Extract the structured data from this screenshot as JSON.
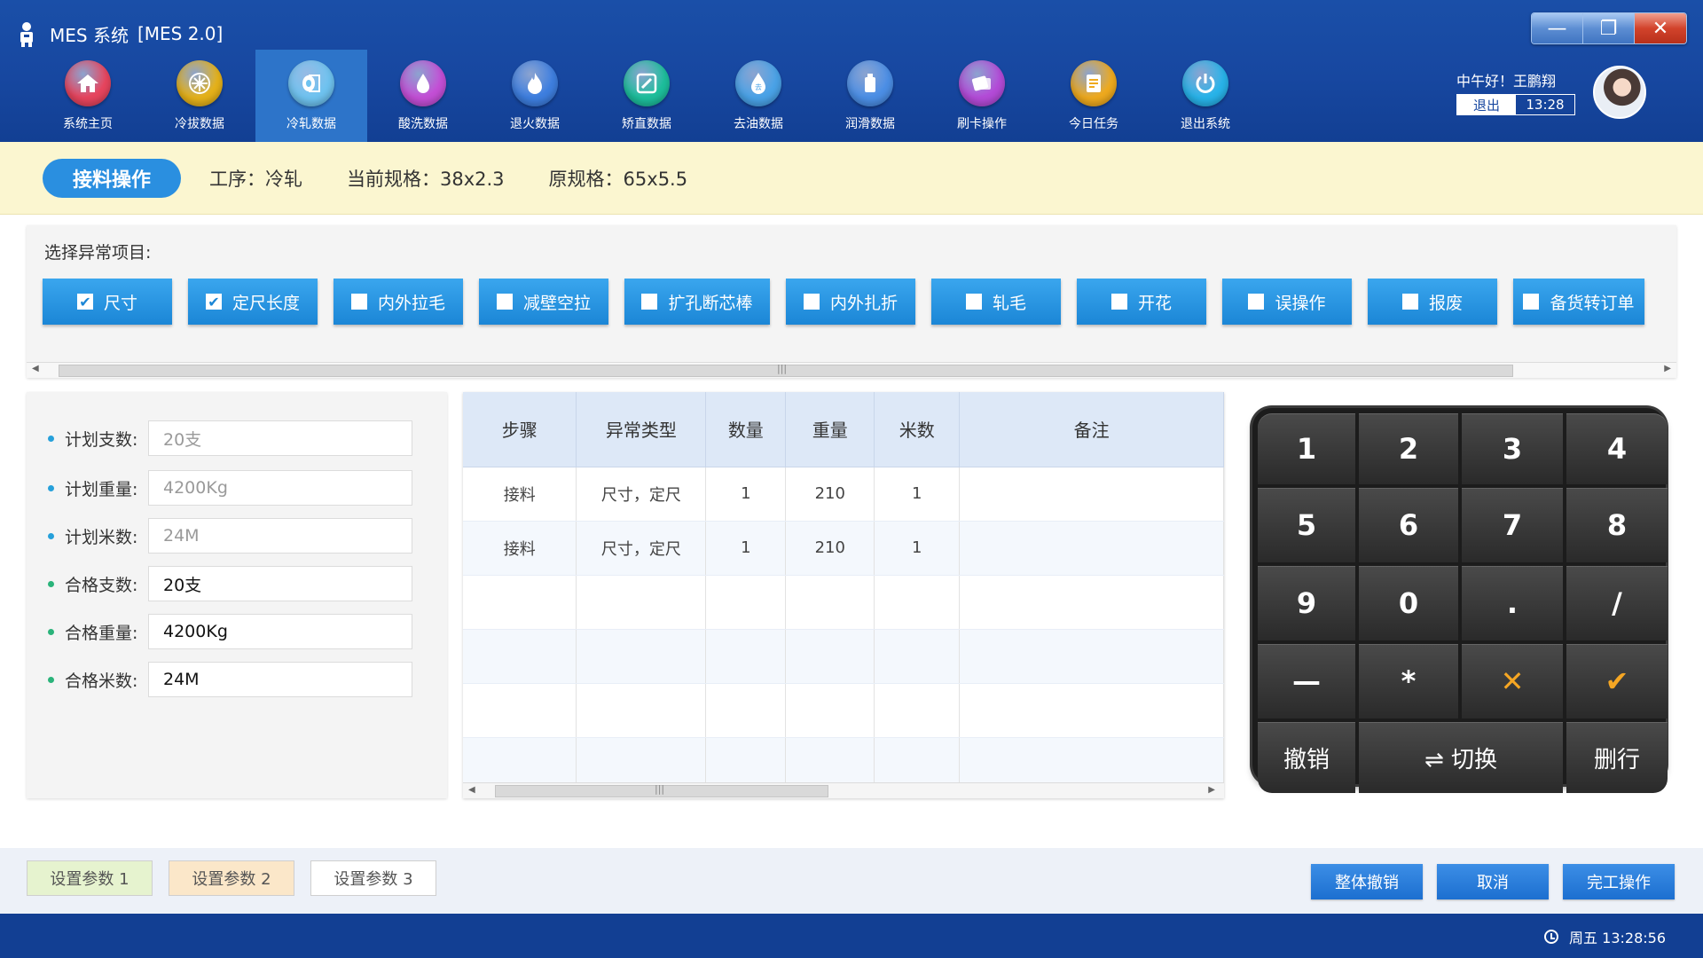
{
  "window": {
    "app_name": "MES 系统",
    "version": "[MES 2.0]",
    "controls": {
      "minimize": "—",
      "maximize": "❐",
      "close": "✕"
    }
  },
  "nav": [
    {
      "label": "系统主页",
      "icon": "home-icon",
      "color": "#e8455e"
    },
    {
      "label": "冷拔数据",
      "icon": "snowflake-icon",
      "color": "#e6b21a"
    },
    {
      "label": "冷轧数据",
      "icon": "roll-icon",
      "color": "#6fc3f0",
      "active": true
    },
    {
      "label": "酸洗数据",
      "icon": "drops-icon",
      "color": "#c44fd6"
    },
    {
      "label": "退火数据",
      "icon": "flame-icon",
      "color": "#3e7fe0"
    },
    {
      "label": "矫直数据",
      "icon": "edit-icon",
      "color": "#1dbf9c"
    },
    {
      "label": "去油数据",
      "icon": "oil-drop-icon",
      "color": "#4aa3e8"
    },
    {
      "label": "润滑数据",
      "icon": "bottle-icon",
      "color": "#4c8fe6"
    },
    {
      "label": "刷卡操作",
      "icon": "card-icon",
      "color": "#b44bd8"
    },
    {
      "label": "今日任务",
      "icon": "task-icon",
      "color": "#efaa1e"
    },
    {
      "label": "退出系统",
      "icon": "power-icon",
      "color": "#28b4ea"
    }
  ],
  "user": {
    "greeting": "中午好！王鹏翔",
    "logout_label": "退出",
    "time": "13:28"
  },
  "infobar": {
    "operation": "接料操作",
    "process": "工序：冷轧",
    "current_spec": "当前规格：38x2.3",
    "original_spec": "原规格：65x5.5"
  },
  "abnormal": {
    "title": "选择异常项目:",
    "items": [
      {
        "label": "尺寸",
        "checked": true
      },
      {
        "label": "定尺长度",
        "checked": true
      },
      {
        "label": "内外拉毛",
        "checked": false
      },
      {
        "label": "减壁空拉",
        "checked": false
      },
      {
        "label": "扩孔断芯棒",
        "checked": false
      },
      {
        "label": "内外扎折",
        "checked": false
      },
      {
        "label": "轧毛",
        "checked": false
      },
      {
        "label": "开花",
        "checked": false
      },
      {
        "label": "误操作",
        "checked": false
      },
      {
        "label": "报废",
        "checked": false
      },
      {
        "label": "备货转订单",
        "checked": false
      }
    ]
  },
  "form": [
    {
      "label": "计划支数:",
      "value": "20支",
      "muted": true
    },
    {
      "label": "计划重量:",
      "value": "4200Kg",
      "muted": true
    },
    {
      "label": "计划米数:",
      "value": "24M",
      "muted": true
    },
    {
      "label": "合格支数:",
      "value": "20支",
      "muted": false
    },
    {
      "label": "合格重量:",
      "value": "4200Kg",
      "muted": false
    },
    {
      "label": "合格米数:",
      "value": "24M",
      "muted": false
    }
  ],
  "table": {
    "columns": [
      "步骤",
      "异常类型",
      "数量",
      "重量",
      "米数",
      "备注"
    ],
    "rows": [
      [
        "接料",
        "尺寸，定尺",
        "1",
        "210",
        "1",
        ""
      ],
      [
        "接料",
        "尺寸，定尺",
        "1",
        "210",
        "1",
        ""
      ],
      [
        "",
        "",
        "",
        "",
        "",
        ""
      ],
      [
        "",
        "",
        "",
        "",
        "",
        ""
      ],
      [
        "",
        "",
        "",
        "",
        "",
        ""
      ],
      [
        "",
        "",
        "",
        "",
        "",
        ""
      ]
    ]
  },
  "keypad": {
    "keys": [
      "1",
      "2",
      "3",
      "4",
      "5",
      "6",
      "7",
      "8",
      "9",
      "0",
      ".",
      "/",
      "—",
      "*",
      "✕",
      "✔"
    ],
    "undo": "撤销",
    "switch": "⇌ 切换",
    "delete_row": "删行"
  },
  "bottom": {
    "params": [
      "设置参数 1",
      "设置参数 2",
      "设置参数 3"
    ],
    "param_colors": [
      "#e6f3cf",
      "#fbe7c9",
      "#ffffff"
    ],
    "actions": [
      "整体撤销",
      "取消",
      "完工操作"
    ]
  },
  "status": {
    "datetime": "周五  13:28:56"
  }
}
